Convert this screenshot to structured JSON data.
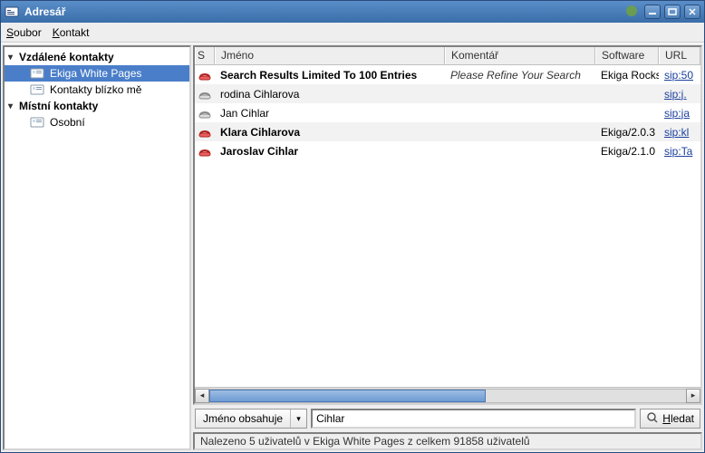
{
  "window": {
    "title": "Adresář"
  },
  "menu": {
    "file": "Soubor",
    "file_ul": "S",
    "contact": "Kontakt",
    "contact_ul": "K"
  },
  "sidebar": {
    "cat_remote": "Vzdálené kontakty",
    "cat_local": "Místní kontakty",
    "items": [
      {
        "label": "Ekiga White Pages"
      },
      {
        "label": "Kontakty blízko mě"
      },
      {
        "label": "Osobní"
      }
    ]
  },
  "table": {
    "headers": {
      "status": "S",
      "name": "Jméno",
      "comment": "Komentář",
      "software": "Software",
      "url": "URL"
    },
    "rows": [
      {
        "name": "Search Results Limited To 100 Entries",
        "comment": "Please Refine Your Search",
        "software": "Ekiga Rocks",
        "url": "sip:50",
        "bold": true,
        "phone": "red"
      },
      {
        "name": "rodina Cihlarova",
        "comment": "",
        "software": "",
        "url": "sip:j.",
        "bold": false,
        "phone": "grey"
      },
      {
        "name": "Jan Cihlar",
        "comment": "",
        "software": "",
        "url": "sip:ja",
        "bold": false,
        "phone": "grey"
      },
      {
        "name": "Klara Cihlarova",
        "comment": "",
        "software": "Ekiga/2.0.3",
        "url": "sip:kl",
        "bold": true,
        "phone": "red"
      },
      {
        "name": "Jaroslav Cihlar",
        "comment": "",
        "software": "Ekiga/2.1.0",
        "url": "sip:Ta",
        "bold": true,
        "phone": "red"
      }
    ]
  },
  "search": {
    "filter_label": "Jméno obsahuje",
    "value": "Cihlar",
    "button": "Hledat",
    "button_ul": "H"
  },
  "status": {
    "text": "Nalezeno 5 uživatelů v Ekiga White Pages z celkem 91858 uživatelů"
  }
}
